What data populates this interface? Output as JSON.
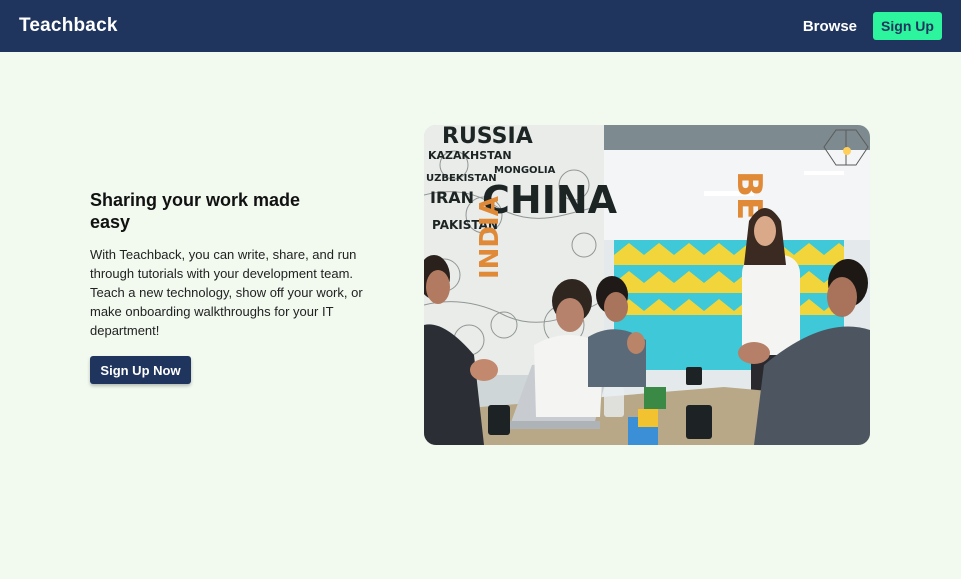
{
  "navbar": {
    "brand": "Teachback",
    "browse_label": "Browse",
    "signup_label": "Sign Up"
  },
  "hero": {
    "title": "Sharing your work made easy",
    "description": "With Teachback, you can write, share, and run through tutorials with your development team. Teach a new technology, show off your work, or make onboarding walkthroughs for your IT department!",
    "cta_label": "Sign Up Now",
    "image": {
      "subject": "office-team-meeting-photo",
      "wall_words": [
        "RUSSIA",
        "KAZAKHSTAN",
        "UZBEKISTAN",
        "MONGOLIA",
        "CHINA",
        "IRAN",
        "PAKISTAN",
        "INDIA"
      ],
      "side_word": "BE"
    }
  },
  "colors": {
    "navbar_bg": "#1f355e",
    "page_bg": "#f2faf0",
    "accent": "#2cf59e",
    "primary_button": "#1f355e"
  }
}
